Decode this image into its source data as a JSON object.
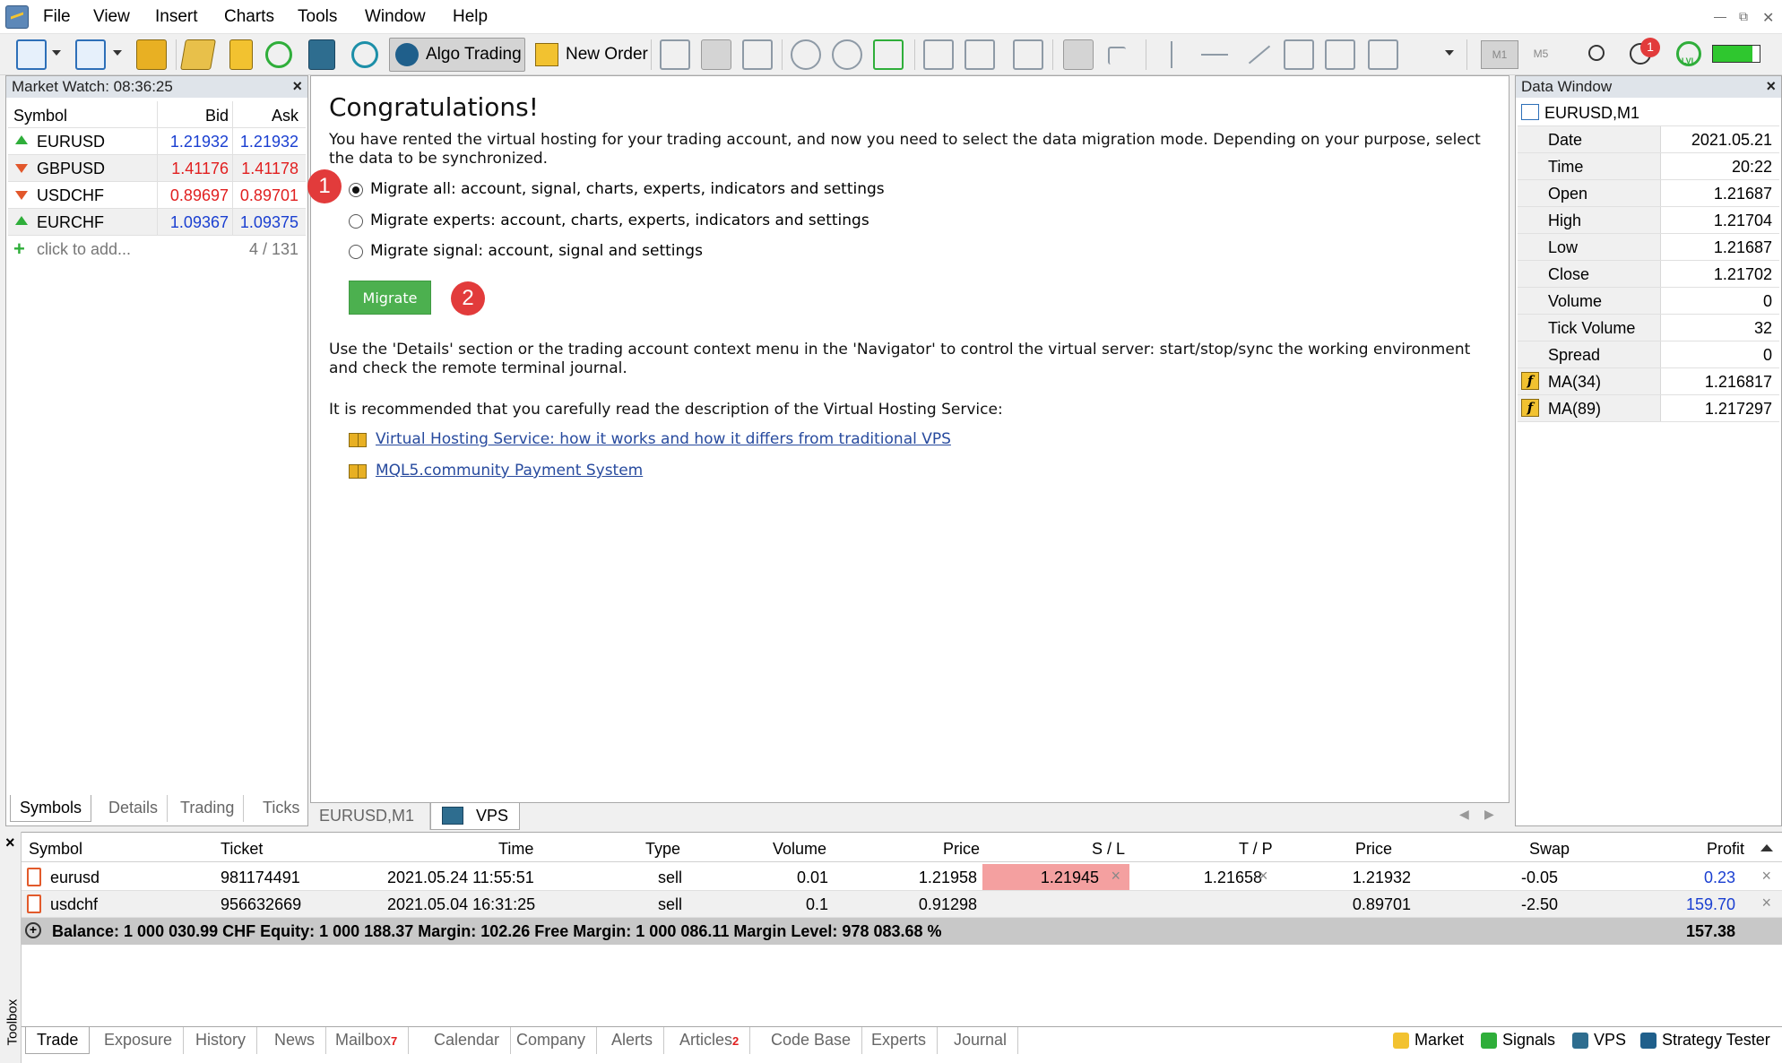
{
  "menu": [
    "File",
    "View",
    "Insert",
    "Charts",
    "Tools",
    "Window",
    "Help"
  ],
  "toolbar": {
    "algo_trading": "Algo Trading",
    "new_order": "New Order",
    "tf_m1": "M1",
    "tf_m5": "M5",
    "notif_count": "1",
    "lvl": "LVL"
  },
  "market_watch": {
    "title": "Market Watch: 08:36:25",
    "columns": [
      "Symbol",
      "Bid",
      "Ask"
    ],
    "rows": [
      {
        "symbol": "EURUSD",
        "bid": "1.21932",
        "ask": "1.21932",
        "dir": "up",
        "color": "#1a3fd1"
      },
      {
        "symbol": "GBPUSD",
        "bid": "1.41176",
        "ask": "1.41178",
        "dir": "down",
        "color": "#e11f1f"
      },
      {
        "symbol": "USDCHF",
        "bid": "0.89697",
        "ask": "0.89701",
        "dir": "down",
        "color": "#e11f1f"
      },
      {
        "symbol": "EURCHF",
        "bid": "1.09367",
        "ask": "1.09375",
        "dir": "up",
        "color": "#1a3fd1"
      }
    ],
    "add_label": "click to add...",
    "count": "4 / 131",
    "tabs": [
      "Symbols",
      "Details",
      "Trading",
      "Ticks"
    ]
  },
  "vps": {
    "heading": "Congratulations!",
    "intro": "You have rented the virtual hosting for your trading account, and now you need to select the data migration mode. Depending on your purpose, select the data to be synchronized.",
    "options": [
      "Migrate all: account, signal, charts, experts, indicators and settings",
      "Migrate experts: account, charts, experts, indicators and settings",
      "Migrate signal: account, signal and settings"
    ],
    "selected_option": 0,
    "badge1": "1",
    "badge2": "2",
    "migrate_label": "Migrate",
    "details_text": "Use the 'Details' section or the trading account context menu in the 'Navigator' to control the virtual server: start/stop/sync the working environment and check the remote terminal journal.",
    "recommend_text": "It is recommended that you carefully read the description of the Virtual Hosting Service:",
    "links": [
      "Virtual Hosting Service: how it works and how it differs from traditional VPS",
      "MQL5.community Payment System"
    ]
  },
  "chart_tabs": [
    "EURUSD,M1",
    "VPS"
  ],
  "data_window": {
    "title": "Data Window",
    "symbol": "EURUSD,M1",
    "rows": [
      {
        "label": "Date",
        "value": "2021.05.21"
      },
      {
        "label": "Time",
        "value": "20:22"
      },
      {
        "label": "Open",
        "value": "1.21687"
      },
      {
        "label": "High",
        "value": "1.21704"
      },
      {
        "label": "Low",
        "value": "1.21687"
      },
      {
        "label": "Close",
        "value": "1.21702"
      },
      {
        "label": "Volume",
        "value": "0"
      },
      {
        "label": "Tick Volume",
        "value": "32"
      },
      {
        "label": "Spread",
        "value": "0"
      }
    ],
    "indicators": [
      {
        "label": "MA(34)",
        "value": "1.216817"
      },
      {
        "label": "MA(89)",
        "value": "1.217297"
      }
    ]
  },
  "trade": {
    "columns": [
      "Symbol",
      "Ticket",
      "Time",
      "Type",
      "Volume",
      "Price",
      "S / L",
      "T / P",
      "Price",
      "Swap",
      "Profit"
    ],
    "rows": [
      {
        "symbol": "eurusd",
        "ticket": "981174491",
        "time": "2021.05.24 11:55:51",
        "type": "sell",
        "volume": "0.01",
        "price": "1.21958",
        "sl": "1.21945",
        "tp": "1.21658",
        "cur_price": "1.21932",
        "swap": "-0.05",
        "profit": "0.23"
      },
      {
        "symbol": "usdchf",
        "ticket": "956632669",
        "time": "2021.05.04 16:31:25",
        "type": "sell",
        "volume": "0.1",
        "price": "0.91298",
        "sl": "",
        "tp": "",
        "cur_price": "0.89701",
        "swap": "-2.50",
        "profit": "159.70"
      }
    ],
    "balance_text": "Balance: 1 000 030.99 CHF  Equity: 1 000 188.37  Margin: 102.26  Free Margin: 1 000 086.11  Margin Level: 978 083.68 %",
    "total_profit": "157.38",
    "side_label": "Toolbox",
    "tabs": [
      {
        "label": "Trade",
        "badge": ""
      },
      {
        "label": "Exposure",
        "badge": ""
      },
      {
        "label": "History",
        "badge": ""
      },
      {
        "label": "News",
        "badge": ""
      },
      {
        "label": "Mailbox",
        "badge": "7"
      },
      {
        "label": "Calendar",
        "badge": ""
      },
      {
        "label": "Company",
        "badge": ""
      },
      {
        "label": "Alerts",
        "badge": ""
      },
      {
        "label": "Articles",
        "badge": "2"
      },
      {
        "label": "Code Base",
        "badge": ""
      },
      {
        "label": "Experts",
        "badge": ""
      },
      {
        "label": "Journal",
        "badge": ""
      }
    ],
    "status_links": [
      "Market",
      "Signals",
      "VPS",
      "Strategy Tester"
    ]
  }
}
